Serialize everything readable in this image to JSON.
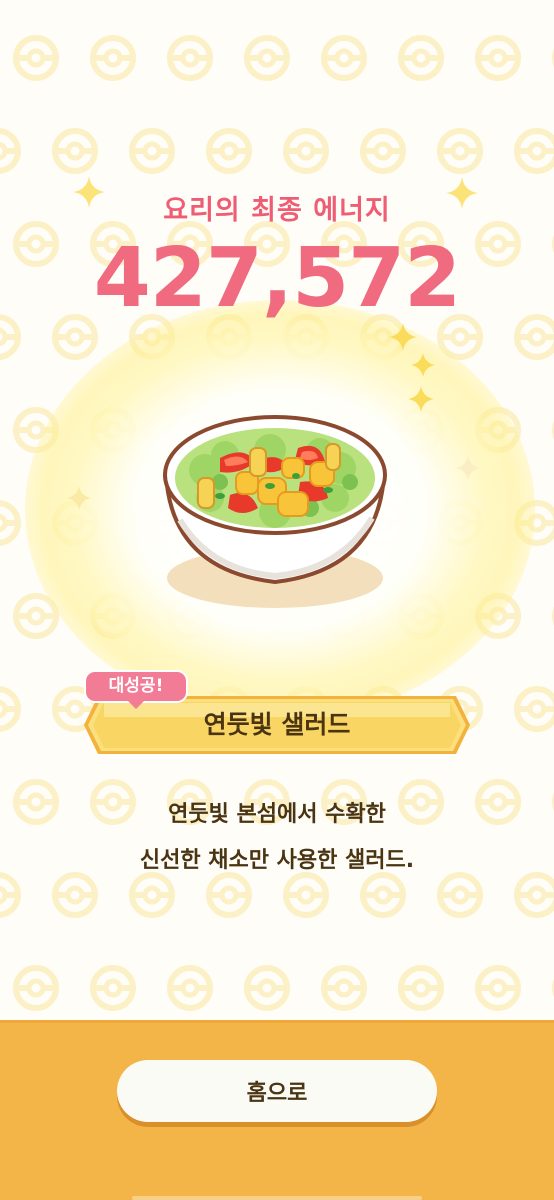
{
  "energy": {
    "label": "요리의 최종 에너지",
    "value": "427,572"
  },
  "dish": {
    "badge": "대성공!",
    "name": "연둣빛 샐러드",
    "description_line1": "연둣빛 본섬에서 수확한",
    "description_line2": "신선한 채소만 사용한 샐러드."
  },
  "actions": {
    "home_label": "홈으로"
  },
  "colors": {
    "energy_text": "#ef5d74",
    "badge_pink": "#f27c96",
    "banner_yellow": "#f9d664",
    "bottom_panel": "#f4b548",
    "button_bg": "#fbfbf6",
    "text_brown": "#4a3412"
  },
  "icons": {
    "background": "pokeball-pattern",
    "sparkles": "sparkle-icon",
    "dish_image": "salad-bowl-illustration"
  }
}
